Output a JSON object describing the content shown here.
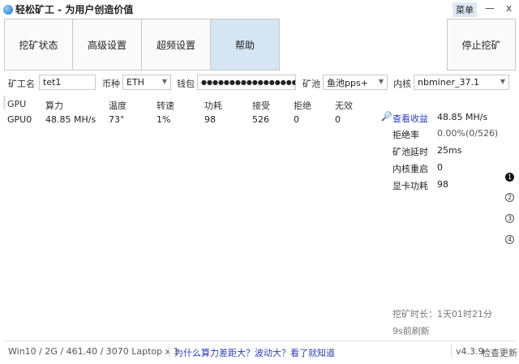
{
  "title": "轻松矿工 - 为用户创造价值",
  "window": {
    "menu": "菜单",
    "minimize": "—",
    "close": "x"
  },
  "tabs": [
    "挖矿状态",
    "高级设置",
    "超频设置",
    "帮助"
  ],
  "stop_button": "停止挖矿",
  "form": {
    "miner_name_label": "矿工名",
    "miner_name": "tet1",
    "coin_label": "币种",
    "coin": "ETH",
    "wallet_label": "钱包",
    "wallet": "●●●●●●●●●●●●●●●●●",
    "pool_label": "矿池",
    "pool": "鱼池pps+",
    "kernel_label": "内核",
    "kernel": "nbminer_37.1"
  },
  "table": {
    "headers": [
      "GPU",
      "算力",
      "温度",
      "转速",
      "功耗",
      "接受",
      "拒绝",
      "无效"
    ],
    "rows": [
      [
        "GPU0",
        "48.85 MH/s",
        "73°",
        "1%",
        "98",
        "526",
        "0",
        "0"
      ]
    ]
  },
  "stats": {
    "view_earnings": "查看收益",
    "hashrate": "48.85 MH/s",
    "items": [
      {
        "label": "拒绝率",
        "value": "0.00%(0/526)"
      },
      {
        "label": "矿池延时",
        "value": "25ms"
      },
      {
        "label": "内核重启",
        "value": "0"
      },
      {
        "label": "显卡功耗",
        "value": "98"
      }
    ]
  },
  "pages": [
    "1",
    "2",
    "3",
    "4"
  ],
  "runtime": {
    "label": "挖矿时长：",
    "value": "1天01时21分",
    "refresh": "9s前刷新"
  },
  "footer": {
    "system": "Win10  / 2G / 461.40 / 3070 Laptop x 1",
    "link": "为什么算力差距大？波动大？看了就知道",
    "version": "v4.3.9",
    "update": "检查更新"
  }
}
